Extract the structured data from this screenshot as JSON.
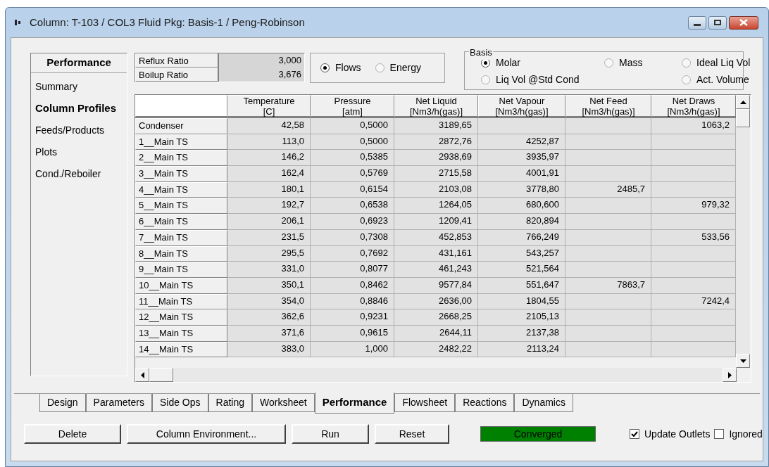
{
  "window": {
    "title": "Column: T-103 / COL3  Fluid Pkg: Basis-1 / Peng-Robinson"
  },
  "sidebar": {
    "heading": "Performance",
    "items": [
      {
        "label": "Summary",
        "selected": false
      },
      {
        "label": "Column Profiles",
        "selected": true
      },
      {
        "label": "Feeds/Products",
        "selected": false
      },
      {
        "label": "Plots",
        "selected": false
      },
      {
        "label": "Cond./Reboiler",
        "selected": false
      }
    ]
  },
  "ratios": [
    {
      "label": "Reflux Ratio",
      "value": "3,000"
    },
    {
      "label": "Boilup Ratio",
      "value": "3,676"
    }
  ],
  "display": [
    {
      "label": "Flows",
      "selected": true
    },
    {
      "label": "Energy",
      "selected": false
    }
  ],
  "basis": {
    "title": "Basis",
    "options": [
      {
        "label": "Molar",
        "selected": true
      },
      {
        "label": "Mass",
        "selected": false
      },
      {
        "label": "Ideal Liq Vol",
        "selected": false
      },
      {
        "label": "Liq Vol @Std Cond",
        "selected": false
      },
      {
        "label": "Act. Volume",
        "selected": false
      }
    ]
  },
  "table": {
    "columns": [
      {
        "name": "Temperature",
        "unit": "[C]"
      },
      {
        "name": "Pressure",
        "unit": "[atm]"
      },
      {
        "name": "Net Liquid",
        "unit": "[Nm3/h(gas)]"
      },
      {
        "name": "Net Vapour",
        "unit": "[Nm3/h(gas)]"
      },
      {
        "name": "Net Feed",
        "unit": "[Nm3/h(gas)]"
      },
      {
        "name": "Net Draws",
        "unit": "[Nm3/h(gas)]"
      }
    ],
    "rows": [
      {
        "label": "Condenser",
        "cells": [
          "42,58",
          "0,5000",
          "3189,65",
          null,
          null,
          "1063,2"
        ]
      },
      {
        "label": "1__Main TS",
        "cells": [
          "113,0",
          "0,5000",
          "2872,76",
          "4252,87",
          null,
          null
        ]
      },
      {
        "label": "2__Main TS",
        "cells": [
          "146,2",
          "0,5385",
          "2938,69",
          "3935,97",
          null,
          null
        ]
      },
      {
        "label": "3__Main TS",
        "cells": [
          "162,4",
          "0,5769",
          "2715,58",
          "4001,91",
          null,
          null
        ]
      },
      {
        "label": "4__Main TS",
        "cells": [
          "180,1",
          "0,6154",
          "2103,08",
          "3778,80",
          "2485,7",
          null
        ]
      },
      {
        "label": "5__Main TS",
        "cells": [
          "192,7",
          "0,6538",
          "1264,05",
          "680,600",
          null,
          "979,32"
        ]
      },
      {
        "label": "6__Main TS",
        "cells": [
          "206,1",
          "0,6923",
          "1209,41",
          "820,894",
          null,
          null
        ]
      },
      {
        "label": "7__Main TS",
        "cells": [
          "231,5",
          "0,7308",
          "452,853",
          "766,249",
          null,
          "533,56"
        ]
      },
      {
        "label": "8__Main TS",
        "cells": [
          "295,5",
          "0,7692",
          "431,161",
          "543,257",
          null,
          null
        ]
      },
      {
        "label": "9__Main TS",
        "cells": [
          "331,0",
          "0,8077",
          "461,243",
          "521,564",
          null,
          null
        ]
      },
      {
        "label": "10__Main TS",
        "cells": [
          "350,1",
          "0,8462",
          "9577,84",
          "551,647",
          "7863,7",
          null
        ]
      },
      {
        "label": "11__Main TS",
        "cells": [
          "354,0",
          "0,8846",
          "2636,00",
          "1804,55",
          null,
          "7242,4"
        ]
      },
      {
        "label": "12__Main TS",
        "cells": [
          "362,6",
          "0,9231",
          "2668,25",
          "2105,13",
          null,
          null
        ]
      },
      {
        "label": "13__Main TS",
        "cells": [
          "371,6",
          "0,9615",
          "2644,11",
          "2137,38",
          null,
          null
        ]
      },
      {
        "label": "14__Main TS",
        "cells": [
          "383,0",
          "1,000",
          "2482,22",
          "2113,24",
          null,
          null
        ]
      }
    ]
  },
  "tabs": [
    {
      "label": "Design",
      "selected": false
    },
    {
      "label": "Parameters",
      "selected": false
    },
    {
      "label": "Side Ops",
      "selected": false
    },
    {
      "label": "Rating",
      "selected": false
    },
    {
      "label": "Worksheet",
      "selected": false
    },
    {
      "label": "Performance",
      "selected": true
    },
    {
      "label": "Flowsheet",
      "selected": false
    },
    {
      "label": "Reactions",
      "selected": false
    },
    {
      "label": "Dynamics",
      "selected": false
    }
  ],
  "buttons": [
    "Delete",
    "Column Environment...",
    "Run",
    "Reset"
  ],
  "status": {
    "label": "Converged",
    "color": "#008000"
  },
  "checkboxes": [
    {
      "label": "Update Outlets",
      "checked": true
    },
    {
      "label": "Ignored",
      "checked": false
    }
  ]
}
